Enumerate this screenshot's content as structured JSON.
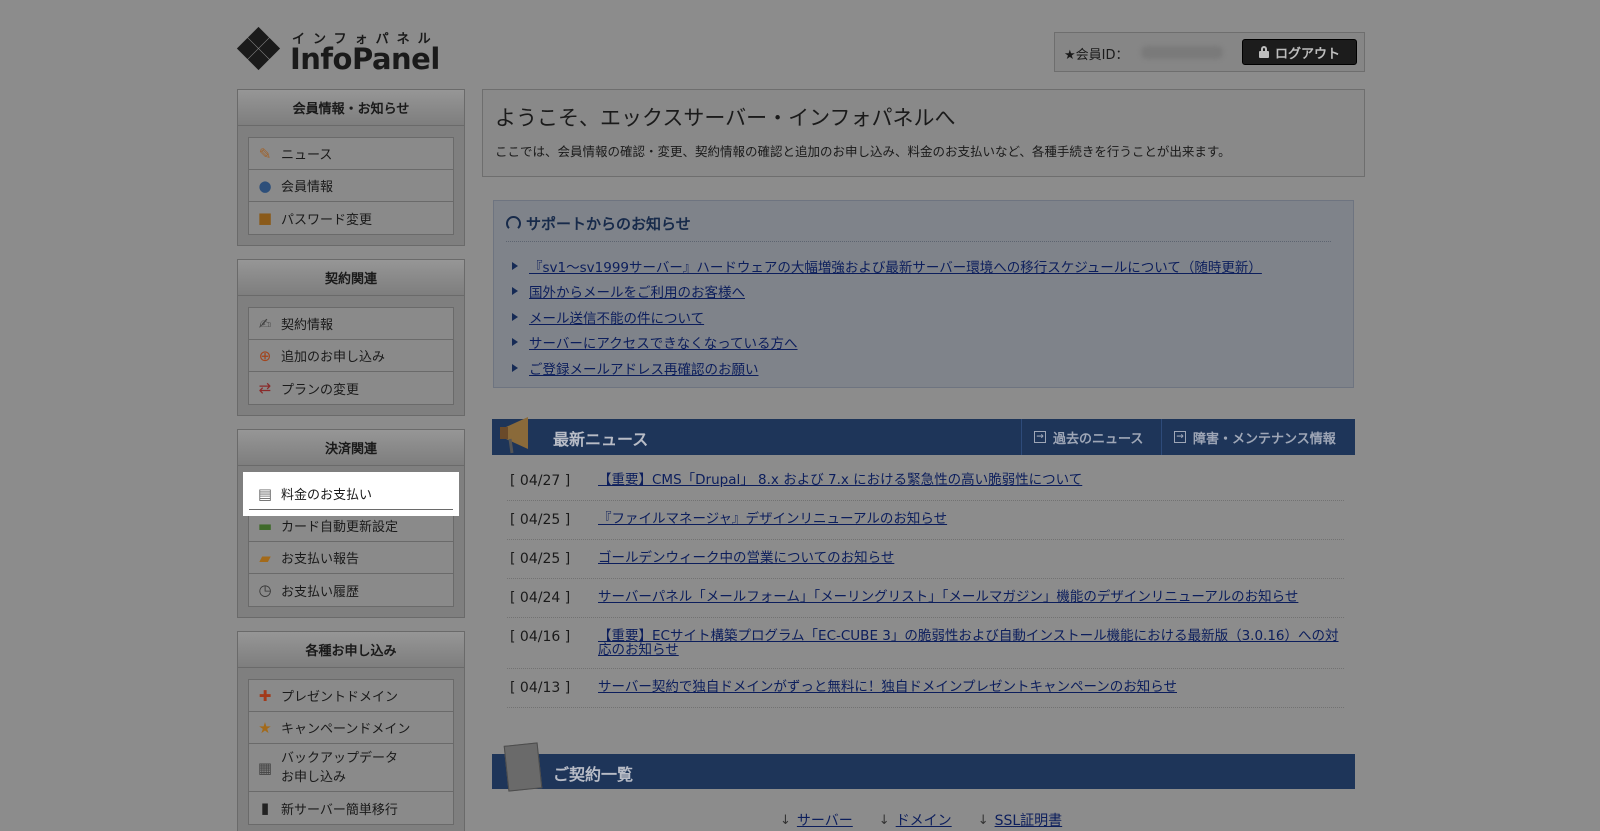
{
  "header": {
    "logo_kana": "インフォパネル",
    "logo_text": "InfoPanel",
    "member_label": "★会員ID：",
    "logout_label": "ログアウト"
  },
  "sidebar": [
    {
      "title": "会員情報・お知らせ",
      "items": [
        {
          "label": "ニュース",
          "icon": "news-icon"
        },
        {
          "label": "会員情報",
          "icon": "user-icon"
        },
        {
          "label": "パスワード変更",
          "icon": "lock-icon"
        }
      ]
    },
    {
      "title": "契約関連",
      "items": [
        {
          "label": "契約情報",
          "icon": "contract-icon"
        },
        {
          "label": "追加のお申し込み",
          "icon": "add-icon"
        },
        {
          "label": "プランの変更",
          "icon": "change-icon"
        }
      ]
    },
    {
      "title": "決済関連",
      "items": [
        {
          "label": "料金のお支払い",
          "icon": "calculator-icon"
        },
        {
          "label": "カード自動更新設定",
          "icon": "card-icon"
        },
        {
          "label": "お支払い報告",
          "icon": "report-icon"
        },
        {
          "label": "お支払い履歴",
          "icon": "clock-icon"
        }
      ]
    },
    {
      "title": "各種お申し込み",
      "items": [
        {
          "label": "プレゼントドメイン",
          "icon": "gift-icon"
        },
        {
          "label": "キャンペーンドメイン",
          "icon": "star-icon"
        },
        {
          "label_line1": "バックアップデータ",
          "label_line2": "お申し込み",
          "icon": "backup-icon"
        },
        {
          "label": "新サーバー簡単移行",
          "icon": "server-icon"
        }
      ]
    }
  ],
  "welcome": {
    "title": "ようこそ、エックスサーバー・インフォパネルへ",
    "description": "ここでは、会員情報の確認・変更、契約情報の確認と追加のお申し込み、料金のお支払いなど、各種手続きを行うことが出来ます。"
  },
  "support": {
    "title": "サポートからのお知らせ",
    "links": [
      "『sv1～sv1999サーバー』ハードウェアの大幅増強および最新サーバー環境への移行スケジュールについて（随時更新）",
      "国外からメールをご利用のお客様へ",
      "メール送信不能の件について",
      "サーバーにアクセスできなくなっている方へ",
      "ご登録メールアドレス再確認のお願い"
    ]
  },
  "news": {
    "title": "最新ニュース",
    "tab_past": "過去のニュース",
    "tab_maintenance": "障害・メンテナンス情報",
    "items": [
      {
        "date": "[ 04/27 ]",
        "title": "【重要】CMS「Drupal」 8.x および 7.x における緊急性の高い脆弱性について"
      },
      {
        "date": "[ 04/25 ]",
        "title": "『ファイルマネージャ』デザインリニューアルのお知らせ"
      },
      {
        "date": "[ 04/25 ]",
        "title": "ゴールデンウィーク中の営業についてのお知らせ"
      },
      {
        "date": "[ 04/24 ]",
        "title": "サーバーパネル「メールフォーム」「メーリングリスト」「メールマガジン」機能のデザインリニューアルのお知らせ"
      },
      {
        "date": "[ 04/16 ]",
        "title": "【重要】ECサイト構築プログラム「EC-CUBE 3」の脆弱性および自動インストール機能における最新版（3.0.16）への対応のお知らせ"
      },
      {
        "date": "[ 04/13 ]",
        "title": "サーバー契約で独自ドメインがずっと無料に！独自ドメインプレゼントキャンペーンのお知らせ"
      }
    ]
  },
  "contracts": {
    "title": "ご契約一覧",
    "links": [
      "サーバー",
      "ドメイン",
      "SSL証明書"
    ]
  }
}
